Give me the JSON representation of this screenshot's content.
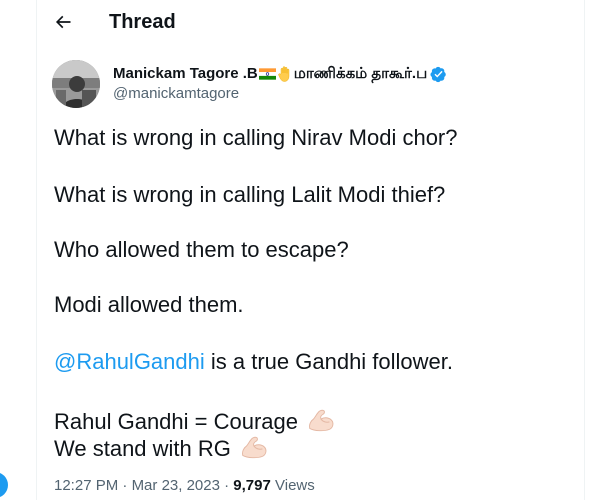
{
  "header": {
    "title": "Thread",
    "back_icon": "arrow-left-icon"
  },
  "author": {
    "name": "Manickam Tagore .B",
    "name_tamil": "மாணிக்கம் தாகூர்.ப",
    "handle": "@manickamtagore",
    "icons": [
      "india-flag-icon",
      "raised-hand-icon",
      "verified-badge-icon"
    ],
    "verified_color": "#1d9bf0"
  },
  "tweet": {
    "line1": "What is wrong in calling Nirav Modi chor?",
    "line2": "What is wrong in calling Lalit Modi thief?",
    "line3": "Who allowed  them to escape?",
    "line4": "Modi allowed them.",
    "mention": "@RahulGandhi",
    "line5_rest": " is a true Gandhi follower.",
    "line6": "Rahul Gandhi = Courage",
    "line7": "We stand with RG",
    "emoji_icon": "flexed-biceps-icon"
  },
  "meta": {
    "time": "12:27 PM",
    "separator": " · ",
    "date": "Mar 23, 2023",
    "views_count": "9,797",
    "views_label": " Views"
  },
  "colors": {
    "text": "#0f1419",
    "secondary": "#536471",
    "link": "#1d9bf0",
    "divider": "#eff3f4"
  }
}
